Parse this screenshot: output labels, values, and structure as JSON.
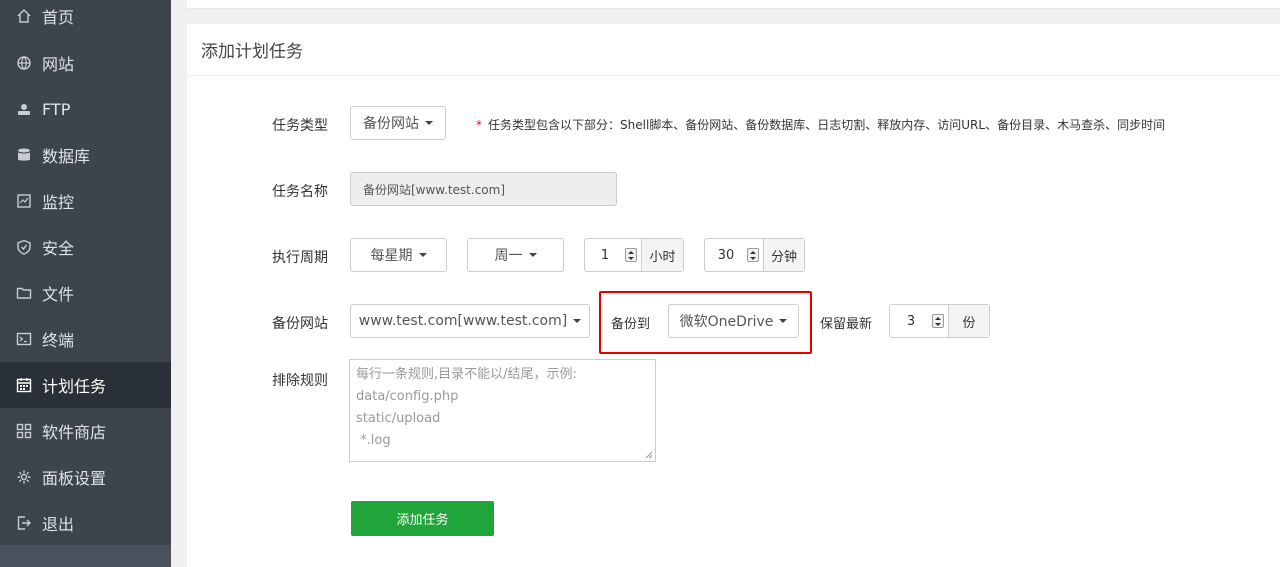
{
  "sidebar": {
    "items": [
      {
        "label": "首页",
        "icon": "home-icon"
      },
      {
        "label": "网站",
        "icon": "globe-icon"
      },
      {
        "label": "FTP",
        "icon": "ftp-icon"
      },
      {
        "label": "数据库",
        "icon": "database-icon"
      },
      {
        "label": "监控",
        "icon": "monitor-icon"
      },
      {
        "label": "安全",
        "icon": "shield-icon"
      },
      {
        "label": "文件",
        "icon": "folder-icon"
      },
      {
        "label": "终端",
        "icon": "terminal-icon"
      },
      {
        "label": "计划任务",
        "icon": "calendar-icon",
        "active": true
      },
      {
        "label": "软件商店",
        "icon": "grid-icon"
      },
      {
        "label": "面板设置",
        "icon": "gear-icon"
      },
      {
        "label": "退出",
        "icon": "logout-icon"
      }
    ]
  },
  "panel": {
    "title": "添加计划任务"
  },
  "form": {
    "task_type": {
      "label": "任务类型",
      "value": "备份网站",
      "hint_star": "*",
      "hint": "任务类型包含以下部分：Shell脚本、备份网站、备份数据库、日志切割、释放内存、访问URL、备份目录、木马查杀、同步时间"
    },
    "task_name": {
      "label": "任务名称",
      "value": "备份网站[www.test.com]"
    },
    "period": {
      "label": "执行周期",
      "cycle": "每星期",
      "weekday": "周一",
      "hour": "1",
      "hour_unit": "小时",
      "minute": "30",
      "minute_unit": "分钟"
    },
    "backup_site": {
      "label": "备份网站",
      "site": "www.test.com[www.test.com]",
      "backup_to_label": "备份到",
      "backup_to": "微软OneDrive",
      "keep_label": "保留最新",
      "keep_count": "3",
      "keep_unit": "份"
    },
    "exclude": {
      "label": "排除规则",
      "placeholder_lines": [
        "每行一条规则,目录不能以/结尾，示例:",
        "data/config.php",
        "static/upload",
        " *.log"
      ]
    },
    "submit_label": "添加任务"
  },
  "colors": {
    "sidebar_bg": "#3c444d",
    "sidebar_active": "#293038",
    "accent_green": "#20a53a",
    "highlight_red": "#e60000"
  }
}
